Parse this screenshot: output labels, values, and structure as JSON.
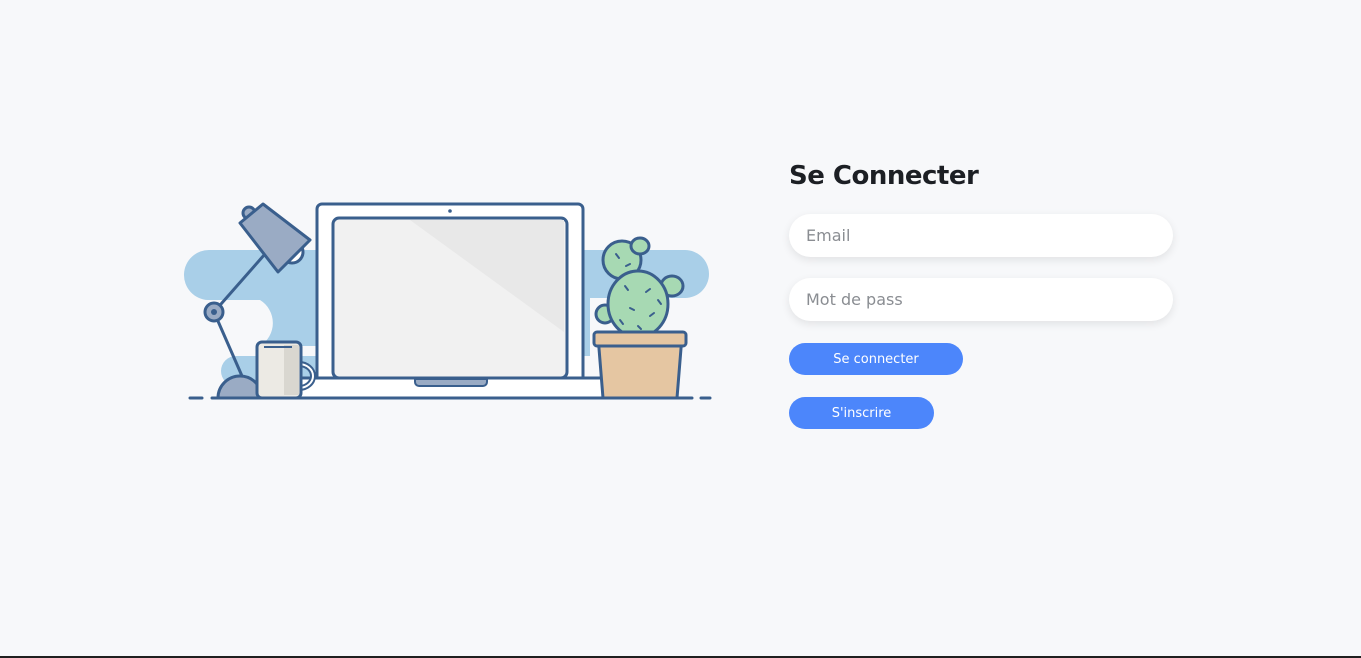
{
  "login_form": {
    "title": "Se Connecter",
    "email_placeholder": "Email",
    "password_placeholder": "Mot de pass",
    "login_button_label": "Se connecter",
    "signup_button_label": "S'inscrire"
  },
  "colors": {
    "background": "#f7f8fa",
    "accent": "#4c86fb",
    "title": "#1c1f24",
    "illustration_outline": "#3a5f8d",
    "illustration_blob": "#a9cfe8"
  }
}
